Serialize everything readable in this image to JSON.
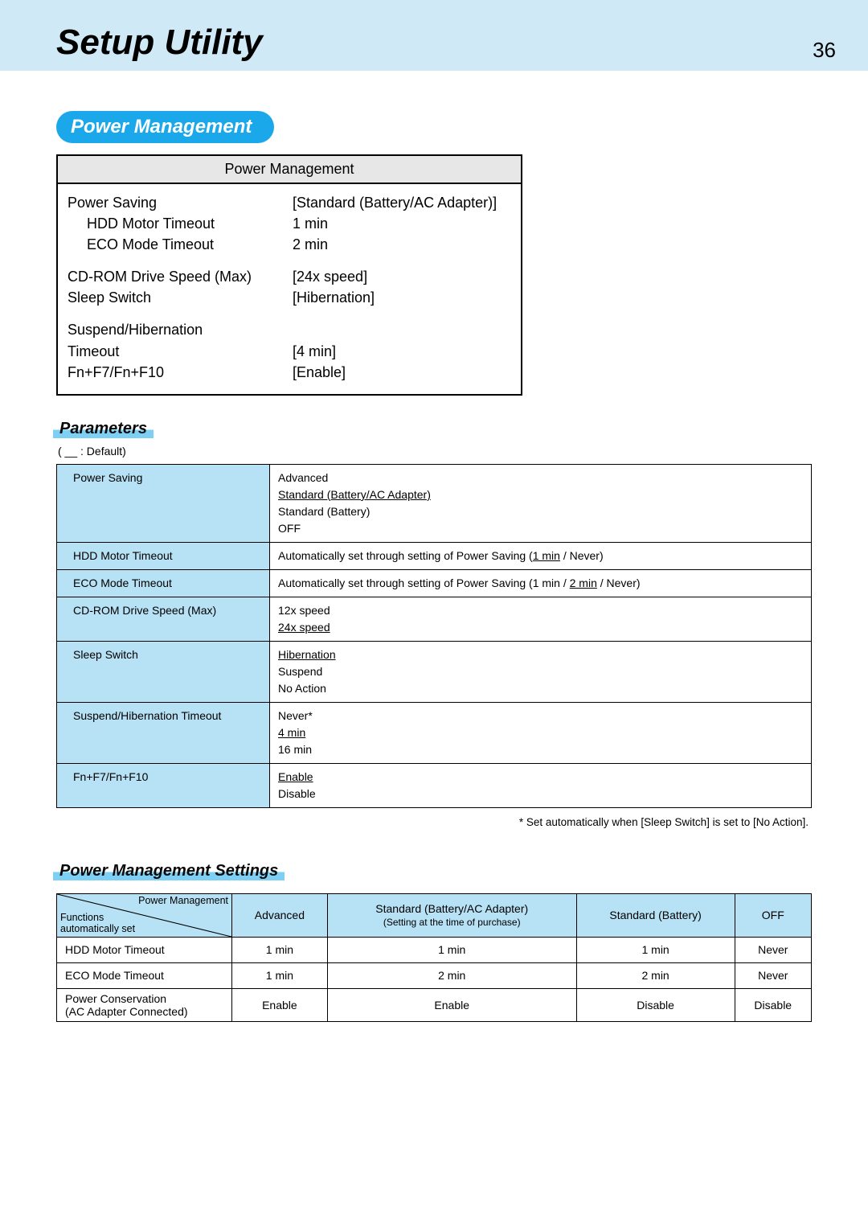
{
  "header": {
    "title": "Setup Utility",
    "page": "36"
  },
  "section": {
    "title": "Power Management"
  },
  "bios": {
    "title": "Power Management",
    "rows": [
      {
        "l": "Power Saving",
        "r": "[Standard (Battery/AC Adapter)]",
        "indent": false
      },
      {
        "l": "HDD Motor Timeout",
        "r": "1 min",
        "indent": true
      },
      {
        "l": "ECO Mode Timeout",
        "r": "2 min",
        "indent": true
      },
      {
        "gap": true
      },
      {
        "l": "CD-ROM Drive Speed (Max)",
        "r": "[24x speed]",
        "indent": false
      },
      {
        "l": "Sleep Switch",
        "r": "[Hibernation]",
        "indent": false
      },
      {
        "gap": true
      },
      {
        "l": "Suspend/Hibernation",
        "r": "",
        "indent": false
      },
      {
        "l": "Timeout",
        "r": "[4 min]",
        "indent": false
      },
      {
        "l": "Fn+F7/Fn+F10",
        "r": "[Enable]",
        "indent": false
      }
    ]
  },
  "parameters": {
    "heading": "Parameters",
    "default_note": "( __ : Default)",
    "rows": [
      {
        "label": "Power Saving",
        "value_html": "Advanced<br><span class='u'>Standard (Battery/AC Adapter)</span><br>Standard (Battery)<br>OFF"
      },
      {
        "label": "HDD Motor Timeout",
        "value_html": "Automatically set through setting of Power Saving (<span class='u'>1 min</span> / Never)"
      },
      {
        "label": "ECO Mode Timeout",
        "value_html": "Automatically set through setting of Power Saving (1 min / <span class='u'>2 min</span> / Never)"
      },
      {
        "label": "CD-ROM Drive Speed (Max)",
        "value_html": "12x speed<br><span class='u'>24x speed</span>"
      },
      {
        "label": "Sleep Switch",
        "value_html": "<span class='u'>Hibernation</span><br>Suspend<br>No Action"
      },
      {
        "label": "Suspend/Hibernation Timeout",
        "value_html": "Never*<br><span class='u'>4 min</span><br>16 min"
      },
      {
        "label": "Fn+F7/Fn+F10",
        "value_html": "<span class='u'>Enable</span><br>Disable"
      }
    ],
    "footnote": "*   Set automatically when [Sleep Switch] is set to [No Action]."
  },
  "settings": {
    "heading": "Power Management Settings",
    "diag": {
      "top": "Power Management",
      "bottom_l1": "Functions",
      "bottom_l2": "automatically set"
    },
    "cols": [
      "Advanced",
      "Standard (Battery/AC Adapter)",
      "Standard (Battery)",
      "OFF"
    ],
    "col_sub": [
      null,
      "(Setting at the time of purchase)",
      null,
      null
    ],
    "rows": [
      {
        "label": "HDD Motor Timeout",
        "cells": [
          "1 min",
          "1 min",
          "1 min",
          "Never"
        ]
      },
      {
        "label": "ECO Mode Timeout",
        "cells": [
          "1 min",
          "2 min",
          "2 min",
          "Never"
        ]
      },
      {
        "label": "Power Conservation\n(AC Adapter Connected)",
        "cells": [
          "Enable",
          "Enable",
          "Disable",
          "Disable"
        ]
      }
    ]
  }
}
